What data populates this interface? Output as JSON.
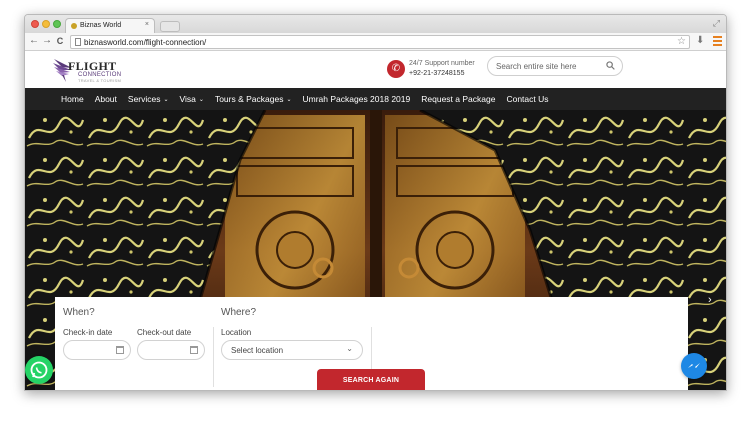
{
  "browser": {
    "tab_title": "Biznas World",
    "tab_close": "×",
    "url": "biznasworld.com/flight-connection/",
    "back": "←",
    "forward": "→",
    "reload": "C",
    "star": "☆"
  },
  "header": {
    "logo_text": "FLIGHT",
    "logo_sub": "CONNECTION",
    "logo_tag": "TRAVEL & TOURISM",
    "support_label": "24/7 Support number",
    "support_number": "+92-21-37248155",
    "search_placeholder": "Search entire site here"
  },
  "nav": {
    "items": [
      {
        "label": "Home"
      },
      {
        "label": "About"
      },
      {
        "label": "Services",
        "caret": "⌄"
      },
      {
        "label": "Visa",
        "caret": "⌄"
      },
      {
        "label": "Tours & Packages",
        "caret": "⌄"
      },
      {
        "label": "Umrah Packages 2018 2019"
      },
      {
        "label": "Request a Package"
      },
      {
        "label": "Contact Us"
      }
    ]
  },
  "booking": {
    "when_title": "When?",
    "where_title": "Where?",
    "checkin_label": "Check-in date",
    "checkout_label": "Check-out date",
    "location_label": "Location",
    "location_value": "Select location",
    "search_button": "SEARCH AGAIN"
  },
  "slider": {
    "next": "›"
  },
  "colors": {
    "brand_red": "#c2272d",
    "nav_bg": "#222222",
    "whatsapp": "#25d366",
    "messenger": "#1e88e5"
  }
}
